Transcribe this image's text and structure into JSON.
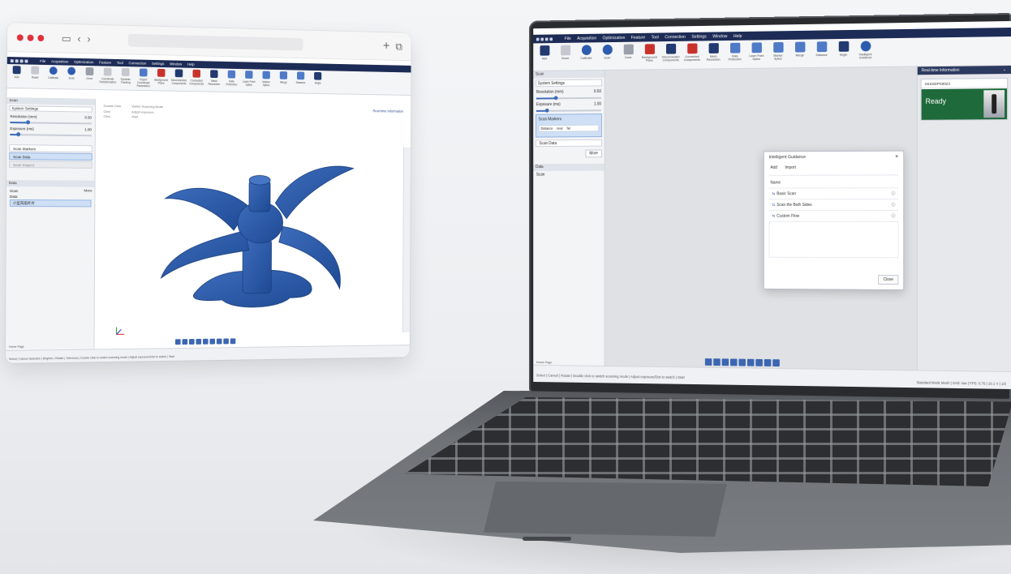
{
  "floating_window": {
    "browser": {
      "sidebar_icon": "sidebar-icon",
      "back_icon": "chevron-left-icon",
      "forward_icon": "chevron-right-icon",
      "new_tab_icon": "plus-icon",
      "tabs_icon": "tabs-icon"
    },
    "app": {
      "menu": [
        "File",
        "Acquisition",
        "Optimization",
        "Feature",
        "Tool",
        "Connection",
        "Settings",
        "Window",
        "Help"
      ],
      "ribbon": [
        {
          "label": "Add",
          "icon": "navy"
        },
        {
          "label": "Reset",
          "icon": "grey2"
        },
        {
          "label": "Calibrate",
          "icon": "blue"
        },
        {
          "label": "Scan",
          "icon": "blue"
        },
        {
          "label": "Done",
          "icon": "gray"
        },
        {
          "label": "Coordinate Transformation",
          "icon": "grey2"
        },
        {
          "label": "Dynamic Tracking",
          "icon": "grey2"
        },
        {
          "label": "Export Coordinate Parameters",
          "icon": "lb"
        },
        {
          "label": "Background Plane",
          "icon": "red"
        },
        {
          "label": "Disconnected Components",
          "icon": "navy"
        },
        {
          "label": "Connected Components",
          "icon": "red"
        },
        {
          "label": "Mesh Resolution",
          "icon": "navy"
        },
        {
          "label": "Data Protection",
          "icon": "lb"
        },
        {
          "label": "Laser Point Splice",
          "icon": "lb"
        },
        {
          "label": "Marker Splice",
          "icon": "lb"
        },
        {
          "label": "Merge",
          "icon": "lb"
        },
        {
          "label": "Distance",
          "icon": "lb"
        },
        {
          "label": "Angle",
          "icon": "navy"
        }
      ],
      "scan_header": "Scan",
      "system_settings": "System Settings",
      "resolution_label": "Resolution (mm)",
      "resolution_value": "0.50",
      "exposure_label": "Exposure (ms)",
      "exposure_value": "1.00",
      "scan_markers": "Scan Markers",
      "scan_data": "Scan Data",
      "third_item": "Scan Inspect",
      "more": "More",
      "data_header": "Data",
      "tree": [
        "Scan",
        "Data"
      ],
      "tree_selected": "小型风扇叶片",
      "hints": [
        {
          "key": "Double Click",
          "icon": "mouse",
          "action": "Switch Scanning Mode"
        },
        {
          "key": "Click",
          "icon": "wheel",
          "action": "Adjust exposure"
        },
        {
          "key": "Click",
          "icon": "play",
          "action": "Start"
        }
      ],
      "realtime_link": "Real-time Information",
      "home_page": "Home Page",
      "status": "Select | Cancel Selection | Brighter | Rotate | Tolerance | Double click to switch scanning mode | Adjust exposure/Dist to switch | Start"
    }
  },
  "laptop_window": {
    "menu": [
      "File",
      "Acquisition",
      "Optimization",
      "Feature",
      "Tool",
      "Connection",
      "Settings",
      "Window",
      "Help"
    ],
    "ribbon": [
      {
        "label": "Add",
        "icon": "navy"
      },
      {
        "label": "Reset",
        "icon": "grey2"
      },
      {
        "label": "Calibrate",
        "icon": "blue"
      },
      {
        "label": "Scan",
        "icon": "blue"
      },
      {
        "label": "Done",
        "icon": "gray"
      },
      {
        "label": "Background Plane",
        "icon": "red"
      },
      {
        "label": "Disconnected Components",
        "icon": "navy"
      },
      {
        "label": "Connected Components",
        "icon": "red"
      },
      {
        "label": "Mesh Resolution",
        "icon": "navy"
      },
      {
        "label": "Data Protection",
        "icon": "lb"
      },
      {
        "label": "Laser Point Splice",
        "icon": "lb"
      },
      {
        "label": "Marker Splice",
        "icon": "lb"
      },
      {
        "label": "Merge",
        "icon": "lb"
      },
      {
        "label": "Distance",
        "icon": "lb"
      },
      {
        "label": "Angle",
        "icon": "navy"
      },
      {
        "label": "Intelligent Guidance",
        "icon": "blue"
      }
    ],
    "scan_header": "Scan",
    "system_settings": "System Settings",
    "resolution_label": "Resolution (mm)",
    "resolution_value": "0.50",
    "exposure_label": "Exposure (ms)",
    "exposure_value": "1.00",
    "scan_markers": "Scan Markers",
    "distance_label": "Distance",
    "distance_near": "near",
    "distance_far": "far",
    "scan_data": "Scan Data",
    "more": "More",
    "data_header": "Data",
    "tree": [
      "Scan"
    ],
    "home_page": "Home Page",
    "realtime_header": "Real-time Information",
    "serial": "SKSSDPS8023",
    "ready": "Ready",
    "dialog": {
      "title": "Intelligent Guidance",
      "tabs": [
        "Add",
        "Import"
      ],
      "col_name": "Name",
      "items": [
        "Basic Scan",
        "Scan the Both Sides",
        "Custom Flow"
      ],
      "close": "Close"
    },
    "status_left": "Select | Cancel | Rotate | Double click to switch scanning mode | Adjust exposure/Dist to switch | Start",
    "status_right": "Standard Mode Mesh | Grid: raw | FPS: 0.76 | 10.1 V | 1/2"
  },
  "colors": {
    "menubar": "#1d2c56",
    "fan": "#2b5aa6",
    "ready": "#1e6a3a",
    "accent": "#3c66b2"
  }
}
